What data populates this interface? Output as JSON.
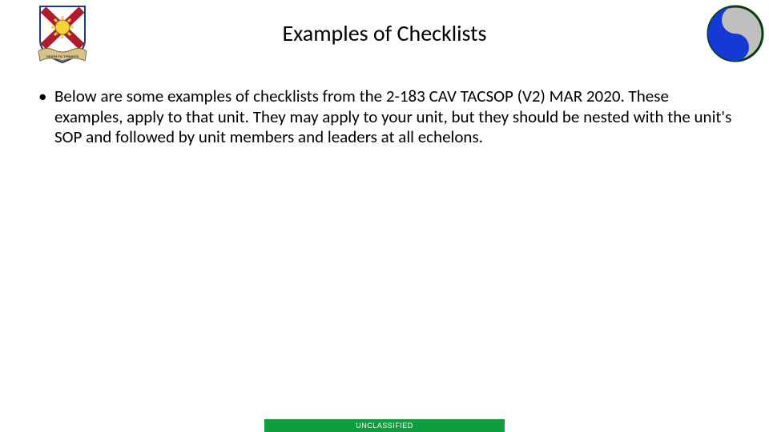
{
  "title": "Examples of Checklists",
  "bullets": [
    "Below are some examples of checklists from the 2-183 CAV TACSOP (V2) MAR 2020. These examples, apply to that unit. They may apply to your unit, but they should be nested with the unit's SOP and followed by unit members and leaders at all echelons."
  ],
  "footer": "UNCLASSIFIED",
  "logos": {
    "left_name": "unit-crest-icon",
    "right_name": "division-patch-icon"
  },
  "colors": {
    "footer_bg": "#0f9d3f",
    "footer_text": "#ffffff"
  }
}
